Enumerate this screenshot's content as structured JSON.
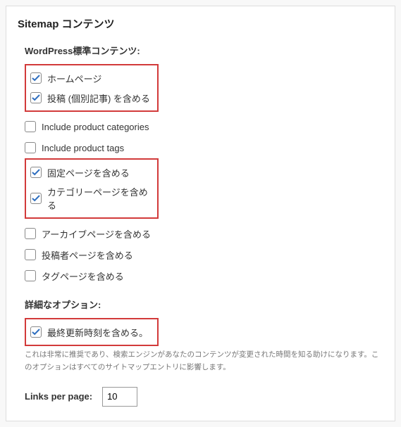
{
  "panel": {
    "title": "Sitemap コンテンツ"
  },
  "standard": {
    "label": "WordPress標準コンテンツ:",
    "group1": [
      {
        "checked": true,
        "label": "ホームページ"
      },
      {
        "checked": true,
        "label": "投稿 (個別記事) を含める"
      }
    ],
    "loose1": [
      {
        "checked": false,
        "label": "Include product categories"
      },
      {
        "checked": false,
        "label": "Include product tags"
      }
    ],
    "group2": [
      {
        "checked": true,
        "label": "固定ページを含める"
      },
      {
        "checked": true,
        "label": "カテゴリーページを含める"
      }
    ],
    "loose2": [
      {
        "checked": false,
        "label": "アーカイブページを含める"
      },
      {
        "checked": false,
        "label": "投稿者ページを含める"
      },
      {
        "checked": false,
        "label": "タグページを含める"
      }
    ]
  },
  "advanced": {
    "label": "詳細なオプション:",
    "group": [
      {
        "checked": true,
        "label": "最終更新時刻を含める。"
      }
    ],
    "help": "これは非常に推奨であり、検索エンジンがあなたのコンテンツが変更された時間を知る助けになります。このオプションはすべてのサイトマップエントリに影響します。"
  },
  "links": {
    "label": "Links per page:",
    "value": "10"
  }
}
